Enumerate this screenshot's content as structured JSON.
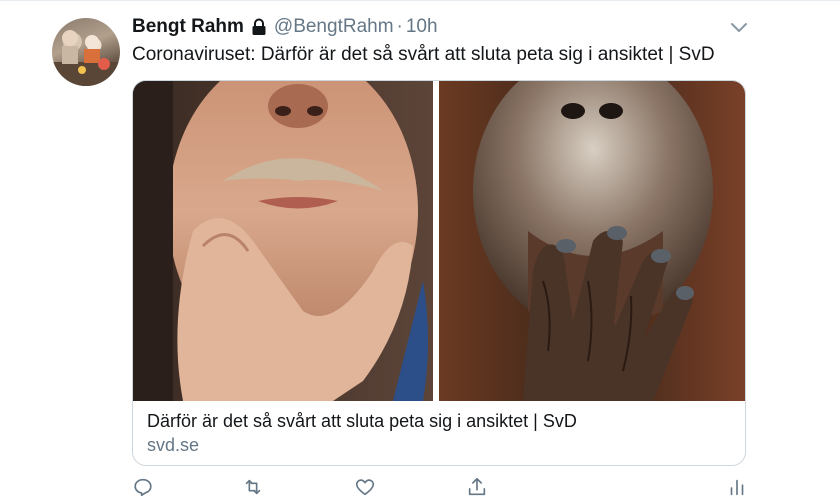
{
  "author": {
    "display_name": "Bengt Rahm",
    "handle": "@BengtRahm",
    "separator": "·",
    "time": "10h"
  },
  "tweet": {
    "text": "Coronaviruset: Därför är det så svårt att sluta peta sig i ansiktet | SvD"
  },
  "card": {
    "title": "Därför är det så svårt att sluta peta sig i ansiktet | SvD",
    "domain": "svd.se"
  },
  "icons": {
    "lock": "lock-icon",
    "menu": "chevron-down-icon",
    "reply": "reply-icon",
    "retweet": "retweet-icon",
    "like": "heart-icon",
    "share": "share-icon",
    "analytics": "analytics-icon"
  },
  "colors": {
    "primary_text": "#14171a",
    "secondary_text": "#657786",
    "border": "#ccd6dd"
  }
}
